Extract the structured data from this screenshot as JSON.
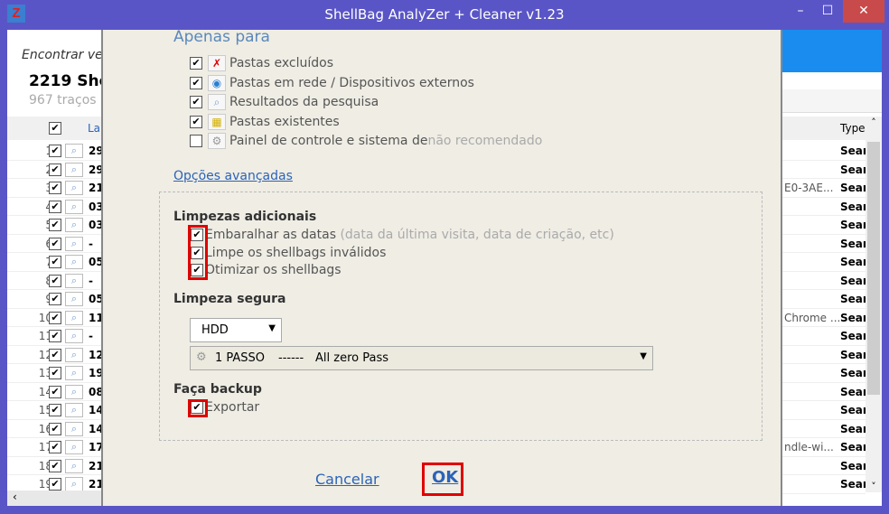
{
  "window": {
    "title": "ShellBag  AnalyZer + Cleaner v1.23",
    "app_icon": "Z",
    "minimize": "–",
    "maximize": "☐",
    "close": "✕"
  },
  "left": {
    "find": "Encontrar ve",
    "count": "2219 She",
    "traces": "967 traços",
    "col_label": "La",
    "rows": [
      {
        "n": "1",
        "d": "29"
      },
      {
        "n": "2",
        "d": "29"
      },
      {
        "n": "3",
        "d": "21"
      },
      {
        "n": "4",
        "d": "03"
      },
      {
        "n": "5",
        "d": "03"
      },
      {
        "n": "6",
        "d": "-"
      },
      {
        "n": "7",
        "d": "05"
      },
      {
        "n": "8",
        "d": "-"
      },
      {
        "n": "9",
        "d": "05"
      },
      {
        "n": "10",
        "d": "11"
      },
      {
        "n": "11",
        "d": "-"
      },
      {
        "n": "12",
        "d": "12"
      },
      {
        "n": "13",
        "d": "19"
      },
      {
        "n": "14",
        "d": "08"
      },
      {
        "n": "15",
        "d": "14"
      },
      {
        "n": "16",
        "d": "14"
      },
      {
        "n": "17",
        "d": "17"
      },
      {
        "n": "18",
        "d": "21"
      },
      {
        "n": "19",
        "d": "21"
      }
    ]
  },
  "right": {
    "type_header": "Type",
    "rows": [
      {
        "p": "",
        "t": "Sear"
      },
      {
        "p": "",
        "t": "Sear"
      },
      {
        "p": "E0-3AE...",
        "t": "Sear"
      },
      {
        "p": "",
        "t": "Sear"
      },
      {
        "p": "",
        "t": "Sear"
      },
      {
        "p": "",
        "t": "Sear"
      },
      {
        "p": "",
        "t": "Sear"
      },
      {
        "p": "",
        "t": "Sear"
      },
      {
        "p": "",
        "t": "Sear"
      },
      {
        "p": "Chrome ...",
        "t": "Sear"
      },
      {
        "p": "",
        "t": "Sear"
      },
      {
        "p": "",
        "t": "Sear"
      },
      {
        "p": "",
        "t": "Sear"
      },
      {
        "p": "",
        "t": "Sear"
      },
      {
        "p": "",
        "t": "Sear"
      },
      {
        "p": "",
        "t": "Sear"
      },
      {
        "p": "ndle-wi...",
        "t": "Sear"
      },
      {
        "p": "",
        "t": "Sear"
      },
      {
        "p": "",
        "t": "Sear"
      }
    ]
  },
  "dialog": {
    "only_for": "Apenas para",
    "options": [
      {
        "label": "Pastas excluídos",
        "checked": true,
        "icon": "✗"
      },
      {
        "label": "Pastas em rede / Dispositivos externos",
        "checked": true,
        "icon": "◉"
      },
      {
        "label": "Resultados da pesquisa",
        "checked": true,
        "icon": "⌕"
      },
      {
        "label": "Pastas existentes",
        "checked": true,
        "icon": "▦"
      },
      {
        "label": "Painel de controle e sistema de",
        "label_grey": "não recomendado",
        "checked": false,
        "icon": "⚙"
      }
    ],
    "advanced": "Opções avançadas",
    "extra_title": "Limpezas adicionais",
    "extra": [
      {
        "label": "Embaralhar as datas",
        "hint": "(data da última visita, data de criação, etc)"
      },
      {
        "label": "Limpe os shellbags inválidos",
        "hint": ""
      },
      {
        "label": "Otimizar os shellbags",
        "hint": ""
      }
    ],
    "secure_title": "Limpeza segura",
    "disk": "HDD",
    "pass_num": "1 PASSO",
    "pass_sep": "------",
    "pass_name": "All zero Pass",
    "backup_title": "Faça backup",
    "export": "Exportar",
    "cancel": "Cancelar",
    "ok": "OK"
  }
}
